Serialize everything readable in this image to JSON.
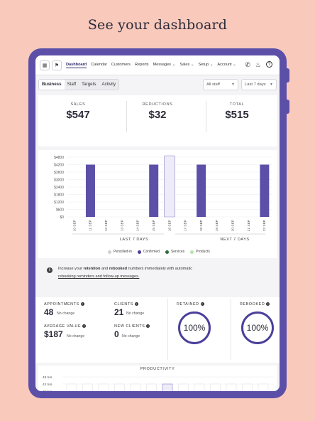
{
  "headline": "See your dashboard",
  "nav": {
    "links": [
      "Dashboard",
      "Calendar",
      "Customers",
      "Reports",
      "Messages ⌄",
      "Sales ⌄",
      "Setup ⌄",
      "Account ⌄"
    ],
    "active": "Dashboard"
  },
  "subnav": {
    "segments": [
      "Business",
      "Staff",
      "Targets",
      "Activity"
    ],
    "active": "Business",
    "staff_select": "All staff",
    "range_select": "Last 7 days"
  },
  "stats": {
    "sales_label": "SALES",
    "sales_value": "$547",
    "reductions_label": "REDUCTIONS",
    "reductions_value": "$32",
    "total_label": "TOTAL",
    "total_value": "$515"
  },
  "chart_data": {
    "type": "bar",
    "categories": [
      "10 SEP",
      "11 SEP",
      "12 SEP",
      "13 SEP",
      "14 SEP",
      "15 SEP",
      "16 SEP",
      "17 SEP",
      "18 SEP",
      "19 SEP",
      "20 SEP",
      "21 SEP",
      "22 SEP"
    ],
    "values": [
      0,
      4200,
      0,
      0,
      0,
      4200,
      0,
      0,
      4200,
      0,
      0,
      0,
      4200
    ],
    "yticks": [
      "$4800",
      "$4200",
      "$3600",
      "$3000",
      "$2400",
      "$1800",
      "$1200",
      "$600",
      "$0"
    ],
    "ylim": [
      0,
      4800
    ],
    "highlight_index": 6,
    "last_label": "LAST 7 DAYS",
    "next_label": "NEXT 7 DAYS",
    "legend": [
      {
        "name": "Pencilled-in",
        "color": "#cfcfd6"
      },
      {
        "name": "Confirmed",
        "color": "#4a3f9b"
      },
      {
        "name": "Services",
        "color": "#2e6b3e"
      },
      {
        "name": "Products",
        "color": "#b8e0b0"
      }
    ],
    "bar_color": "#5b4fa8"
  },
  "banner": {
    "line1_a": "Increase your ",
    "line1_b": "retention",
    "line1_c": " and ",
    "line1_d": "rebooked",
    "line1_e": " numbers immediately with automatic",
    "line2": "rebooking reminders and follow-up messages."
  },
  "metrics": {
    "appointments_label": "APPOINTMENTS",
    "appointments_value": "48",
    "appointments_sub": "No change",
    "clients_label": "CLIENTS",
    "clients_value": "21",
    "clients_sub": "No change",
    "avg_label": "AVERAGE VALUE",
    "avg_value": "$187",
    "avg_sub": "No change",
    "new_label": "NEW CLIENTS",
    "new_value": "0",
    "new_sub": "No change",
    "retained_label": "RETAINED",
    "retained_value": "100%",
    "rebooked_label": "REBOOKED",
    "rebooked_value": "100%"
  },
  "productivity": {
    "title": "PRODUCTIVITY",
    "yticks": [
      "48 hrs",
      "42 hrs",
      "36 hrs"
    ]
  }
}
